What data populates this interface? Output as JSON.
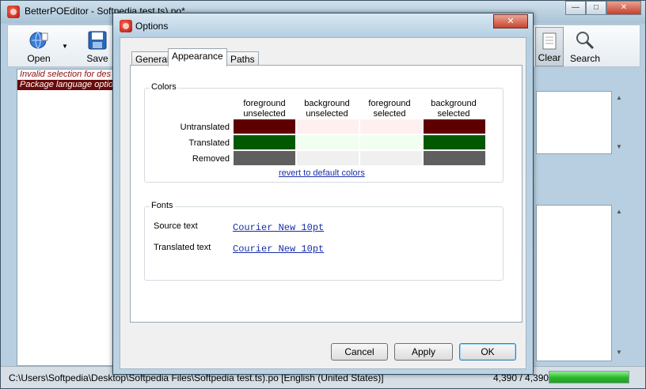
{
  "main_window": {
    "title": "BetterPOEditor - Softpedia test.ts).po*",
    "controls": {
      "minimize": "—",
      "maximize": "□",
      "close": "✕"
    }
  },
  "toolbar": {
    "open_label": "Open",
    "save_label": "Save",
    "clear_label": "Clear",
    "search_label": "Search"
  },
  "errors": [
    {
      "text": "Invalid selection for des"
    },
    {
      "text": "Package language optio"
    }
  ],
  "status_bar": {
    "path": "C:\\Users\\Softpedia\\Desktop\\Softpedia Files\\Softpedia test.ts).po [English (United States)]",
    "count": "4,390 / 4,390",
    "progress": 1.0
  },
  "options_dialog": {
    "title": "Options",
    "close_label": "✕",
    "tabs": [
      {
        "label": "General",
        "active": false
      },
      {
        "label": "Appearance",
        "active": true
      },
      {
        "label": "Paths",
        "active": false
      }
    ],
    "colors": {
      "group_title": "Colors",
      "column_headers": [
        {
          "line1": "foreground",
          "line2": "unselected"
        },
        {
          "line1": "background",
          "line2": "unselected"
        },
        {
          "line1": "foreground",
          "line2": "selected"
        },
        {
          "line1": "background",
          "line2": "selected"
        }
      ],
      "rows": [
        {
          "label": "Untranslated",
          "swatches": [
            "#5e0000",
            "#fff0f0",
            "#fff0f0",
            "#5e0000"
          ]
        },
        {
          "label": "Translated",
          "swatches": [
            "#005900",
            "#f0fff0",
            "#f0fff0",
            "#005900"
          ]
        },
        {
          "label": "Removed",
          "swatches": [
            "#5f5f5f",
            "#f0f0f0",
            "#f0f0f0",
            "#5f5f5f"
          ]
        }
      ],
      "revert_link": "revert to default colors"
    },
    "fonts": {
      "group_title": "Fonts",
      "source_label": "Source text",
      "source_value": "Courier New 10pt",
      "translated_label": "Translated text",
      "translated_value": "Courier New 10pt"
    },
    "buttons": {
      "cancel": "Cancel",
      "apply": "Apply",
      "ok": "OK"
    }
  }
}
